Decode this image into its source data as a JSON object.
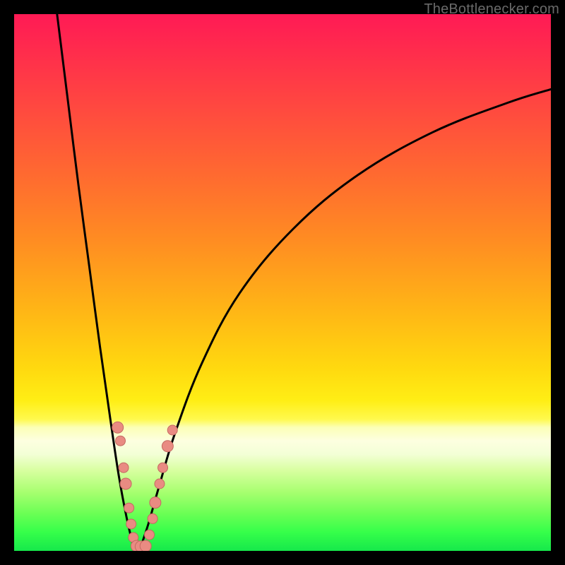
{
  "watermark": "TheBottlenecker.com",
  "colors": {
    "frame": "#000000",
    "curve": "#000000",
    "marker_fill": "#e98b82",
    "marker_stroke": "#c46a61",
    "gradient_stops": [
      "#ff1a55",
      "#ff2f4b",
      "#ff4a3f",
      "#ff6a30",
      "#ff8c22",
      "#ffb516",
      "#ffd90f",
      "#ffee15",
      "#fff94e",
      "#fbffb6",
      "#fdffe0",
      "#f3ffd6",
      "#d8ffa0",
      "#a8ff70",
      "#6cff55",
      "#36ff4a",
      "#16e84b"
    ]
  },
  "chart_data": {
    "type": "line",
    "title": "",
    "xlabel": "",
    "ylabel": "",
    "xlim": [
      0,
      100
    ],
    "ylim": [
      0,
      100
    ],
    "grid": false,
    "legend": false,
    "series": [
      {
        "name": "left-branch",
        "x": [
          8,
          10,
          12,
          14,
          16,
          18,
          19.5,
          21,
          22.3
        ],
        "y": [
          100,
          84,
          68,
          53,
          38,
          24,
          14,
          6,
          0.5
        ]
      },
      {
        "name": "right-branch",
        "x": [
          23.5,
          25,
          27,
          30,
          35,
          42,
          52,
          64,
          78,
          92,
          100
        ],
        "y": [
          0.5,
          5,
          12,
          22,
          35,
          48,
          60,
          70,
          78,
          83.5,
          86
        ]
      }
    ],
    "markers": [
      {
        "x": 19.3,
        "y": 23.0,
        "r": 8
      },
      {
        "x": 19.8,
        "y": 20.5,
        "r": 7
      },
      {
        "x": 20.4,
        "y": 15.5,
        "r": 7
      },
      {
        "x": 20.8,
        "y": 12.5,
        "r": 8
      },
      {
        "x": 21.4,
        "y": 8.0,
        "r": 7
      },
      {
        "x": 21.8,
        "y": 5.0,
        "r": 7
      },
      {
        "x": 22.2,
        "y": 2.5,
        "r": 7
      },
      {
        "x": 22.8,
        "y": 0.9,
        "r": 8
      },
      {
        "x": 23.6,
        "y": 0.8,
        "r": 8
      },
      {
        "x": 24.5,
        "y": 0.9,
        "r": 8
      },
      {
        "x": 25.2,
        "y": 3.0,
        "r": 7
      },
      {
        "x": 25.8,
        "y": 6.0,
        "r": 7
      },
      {
        "x": 26.3,
        "y": 9.0,
        "r": 8
      },
      {
        "x": 27.1,
        "y": 12.5,
        "r": 7
      },
      {
        "x": 27.7,
        "y": 15.5,
        "r": 7
      },
      {
        "x": 28.6,
        "y": 19.5,
        "r": 8
      },
      {
        "x": 29.5,
        "y": 22.5,
        "r": 7
      }
    ]
  }
}
